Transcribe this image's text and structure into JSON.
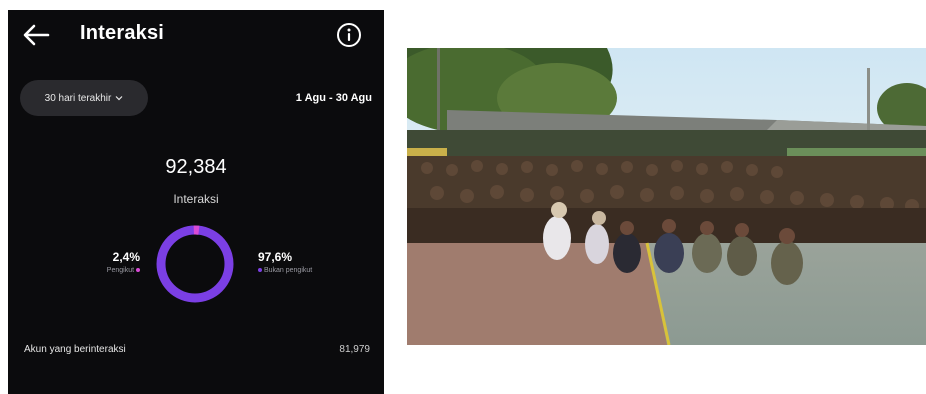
{
  "header": {
    "title": "Interaksi",
    "back_icon": "arrow-left-icon",
    "info_icon": "info-circle-icon"
  },
  "filter": {
    "range_label": "30 hari terakhir",
    "date_range": "1 Agu - 30 Agu"
  },
  "summary": {
    "total": "92,384",
    "total_label": "Interaksi"
  },
  "breakdown": {
    "followers": {
      "percent": "2,4%",
      "label": "Pengikut",
      "fraction": 0.024
    },
    "non_followers": {
      "percent": "97,6%",
      "label": "Bukan pengikut",
      "fraction": 0.976
    }
  },
  "accounts": {
    "label": "Akun yang berinteraksi",
    "value": "81,979"
  },
  "colors": {
    "background": "#0b0b0d",
    "accent_purple": "#7b3fe4",
    "follower_pink": "#d94bd6"
  }
}
